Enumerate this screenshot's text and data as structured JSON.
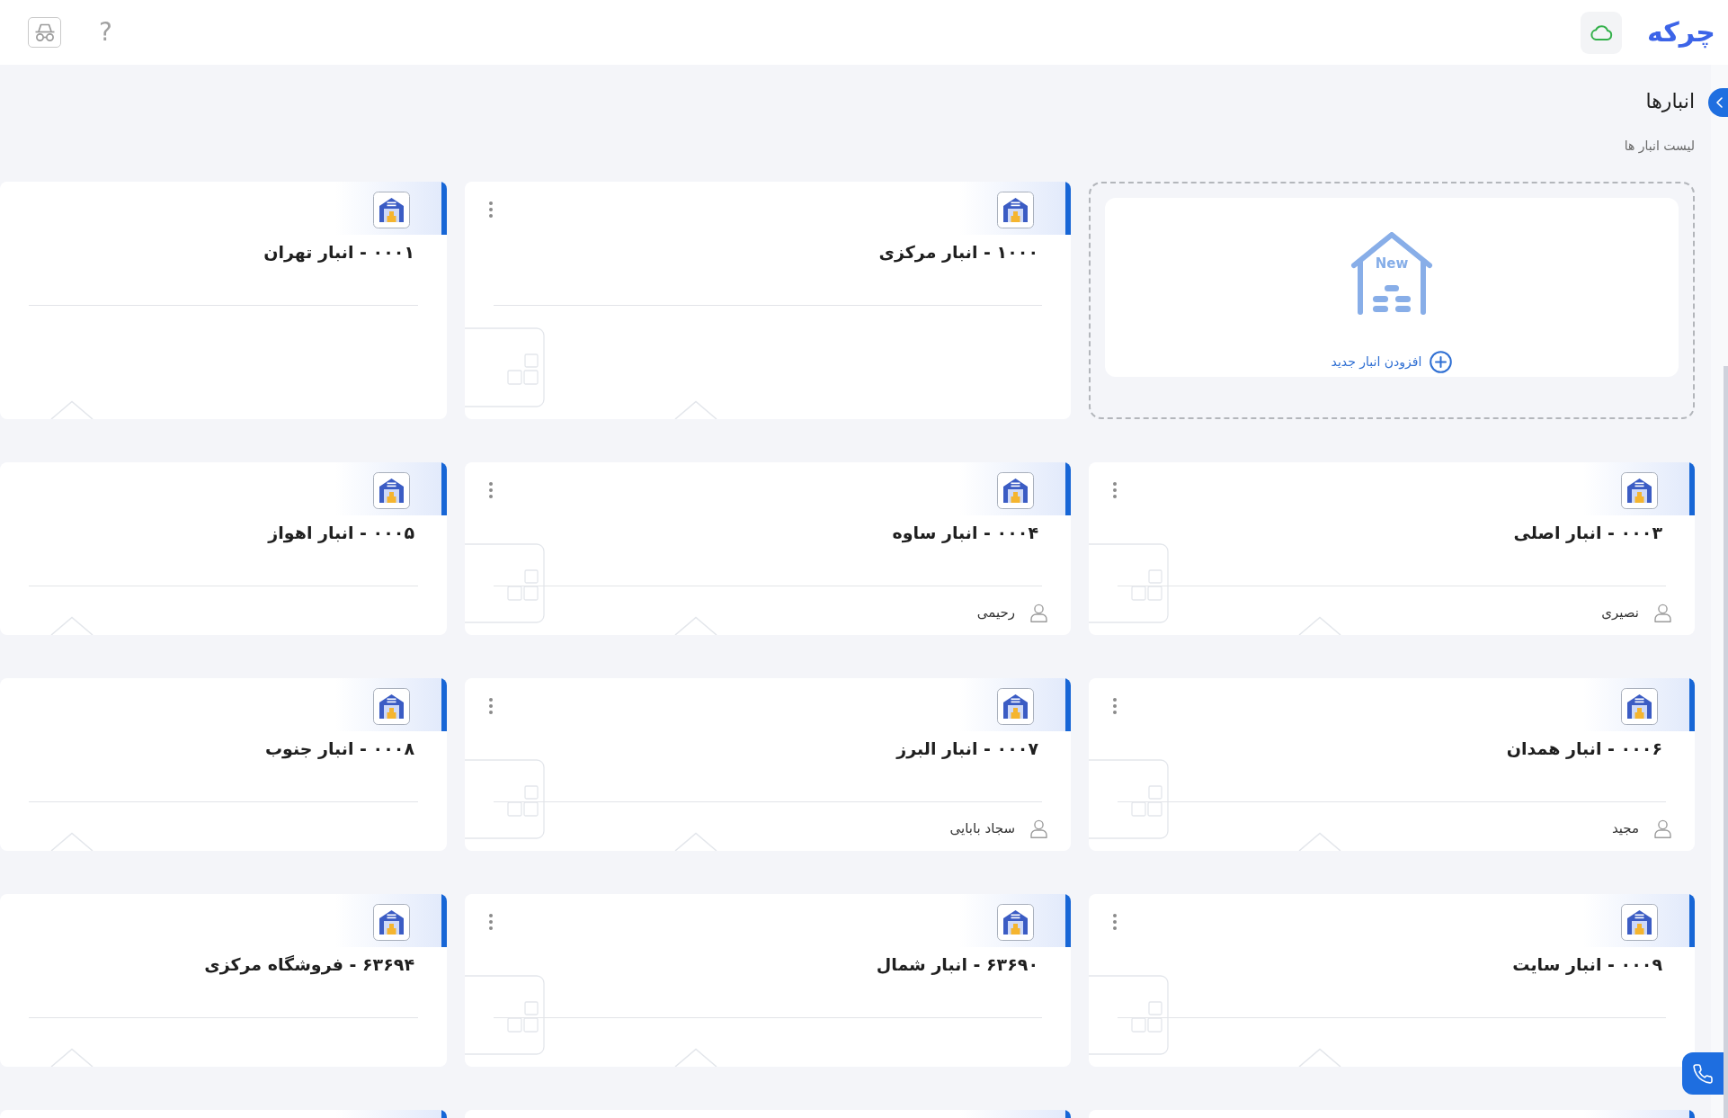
{
  "topbar": {
    "logo": "چرکه",
    "help": "?"
  },
  "page": {
    "title": "انبارها",
    "subtitle": "لیست انبار ها"
  },
  "cards": [
    {
      "kind": "add",
      "badge": "New",
      "action": "افزودن انبار جدید"
    },
    {
      "kind": "warehouse",
      "title": "۱۰۰۰ - انبار مرکزی",
      "menu": true
    },
    {
      "kind": "warehouse",
      "title": "۰۰۰۱ - انبار تهران",
      "menu": false
    },
    {
      "kind": "warehouse",
      "title": "۰۰۰۳ - انبار اصلی",
      "keeper": "نصیری",
      "menu": true
    },
    {
      "kind": "warehouse",
      "title": "۰۰۰۴ - انبار ساوه",
      "keeper": "رحیمی",
      "menu": true
    },
    {
      "kind": "warehouse",
      "title": "۰۰۰۵ - انبار اهواز",
      "menu": false
    },
    {
      "kind": "warehouse",
      "title": "۰۰۰۶ - انبار همدان",
      "keeper": "مجید",
      "menu": true
    },
    {
      "kind": "warehouse",
      "title": "۰۰۰۷ - انبار البرز",
      "keeper": "سجاد بابایی",
      "menu": true
    },
    {
      "kind": "warehouse",
      "title": "۰۰۰۸ - انبار جنوب",
      "menu": false
    },
    {
      "kind": "warehouse",
      "title": "۰۰۰۹ - انبار سایت",
      "menu": true
    },
    {
      "kind": "warehouse",
      "title": "۶۳۶۹۰ - انبار شمال",
      "menu": true
    },
    {
      "kind": "warehouse",
      "title": "۶۳۶۹۴ - فروشگاه مرکزی",
      "menu": false
    },
    {
      "kind": "partial"
    },
    {
      "kind": "partial"
    },
    {
      "kind": "partial"
    }
  ]
}
